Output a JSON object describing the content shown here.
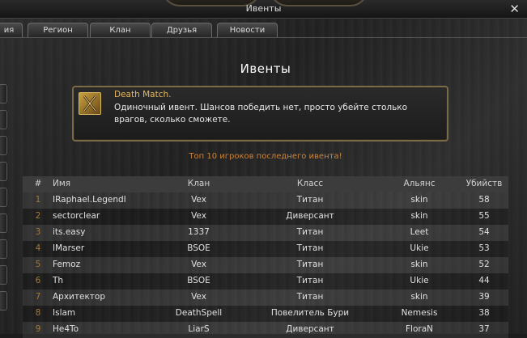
{
  "window": {
    "title": "Ивенты",
    "close_label": "✕"
  },
  "tabs": [
    {
      "label": "ия"
    },
    {
      "label": "Регион"
    },
    {
      "label": "Клан"
    },
    {
      "label": "Друзья"
    },
    {
      "label": "Новости"
    }
  ],
  "page": {
    "title": "Ивенты"
  },
  "event": {
    "name": "Death Match.",
    "description": " Одиночный ивент. Шансов победить нет, просто убейте столько врагов, сколько сможете.",
    "icon": "crossed-swords-icon"
  },
  "top10_label": "Топ 10 игроков последнего ивента!",
  "table": {
    "columns": [
      "#",
      "Имя",
      "Клан",
      "Класс",
      "Альянс",
      "Убийств"
    ],
    "rows": [
      [
        "1",
        "IRaphael.LegendI",
        "Vex",
        "Титан",
        "skin",
        "58"
      ],
      [
        "2",
        "sectorclear",
        "Vex",
        "Диверсант",
        "skin",
        "55"
      ],
      [
        "3",
        "its.easy",
        "1337",
        "Титан",
        "Leet",
        "54"
      ],
      [
        "4",
        "IMarser",
        "BSOE",
        "Титан",
        "Ukie",
        "53"
      ],
      [
        "5",
        "Femoz",
        "Vex",
        "Титан",
        "skin",
        "52"
      ],
      [
        "6",
        "Th",
        "BSOE",
        "Титан",
        "Ukie",
        "44"
      ],
      [
        "7",
        "Архитектор",
        "Vex",
        "Титан",
        "skin",
        "39"
      ],
      [
        "8",
        "Islam",
        "DeathSpell",
        "Повелитель Бури",
        "Nemesis",
        "38"
      ],
      [
        "9",
        "He4To",
        "LiarS",
        "Диверсант",
        "FloraN",
        "37"
      ]
    ]
  },
  "colors": {
    "accent_gold": "#e8b860",
    "top10_orange": "#c8843c",
    "frame_gold": "#7a6a48"
  }
}
